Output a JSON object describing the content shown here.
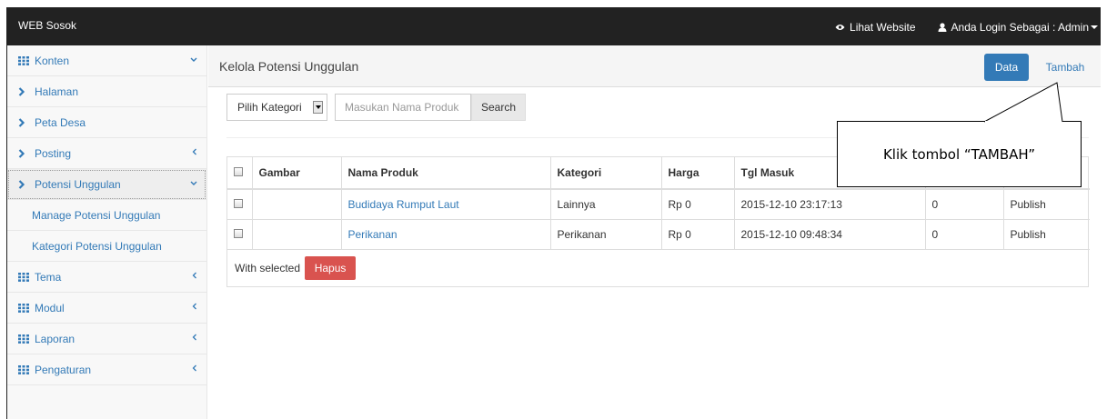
{
  "topbar": {
    "brand": "WEB Sosok",
    "view_site": "Lihat Website",
    "user": "Anda Login Sebagai : Admin"
  },
  "sidebar": {
    "items": [
      {
        "label": "Konten",
        "icon": "grid-icon",
        "arrow": "down"
      },
      {
        "label": "Halaman",
        "icon": "chevron-right-icon"
      },
      {
        "label": "Peta Desa",
        "icon": "chevron-right-icon"
      },
      {
        "label": "Posting",
        "icon": "chevron-right-icon",
        "arrow": "left"
      },
      {
        "label": "Potensi Unggulan",
        "icon": "chevron-right-icon",
        "arrow": "down",
        "active": true
      },
      {
        "label": "Manage Potensi Unggulan",
        "sub": true
      },
      {
        "label": "Kategori Potensi Unggulan",
        "sub": true
      },
      {
        "label": "Tema",
        "icon": "grid-icon",
        "arrow": "left"
      },
      {
        "label": "Modul",
        "icon": "grid-icon",
        "arrow": "left"
      },
      {
        "label": "Laporan",
        "icon": "grid-icon",
        "arrow": "left"
      },
      {
        "label": "Pengaturan",
        "icon": "grid-icon",
        "arrow": "left"
      }
    ]
  },
  "main": {
    "title": "Kelola Potensi Unggulan",
    "data_button": "Data",
    "add_button": "Tambah",
    "filter": {
      "category_selected": "Pilih Kategori",
      "search_placeholder": "Masukan Nama Produk",
      "search_button": "Search"
    },
    "table": {
      "headers": [
        "Gambar",
        "Nama Produk",
        "Kategori",
        "Harga",
        "Tgl Masuk",
        "",
        ""
      ],
      "rows": [
        {
          "name": "Budidaya Rumput Laut",
          "category": "Lainnya",
          "price": "Rp 0",
          "date": "2015-12-10 23:17:13",
          "count": "0",
          "status": "Publish"
        },
        {
          "name": "Perikanan",
          "category": "Perikanan",
          "price": "Rp 0",
          "date": "2015-12-10 09:48:34",
          "count": "0",
          "status": "Publish"
        }
      ]
    },
    "with_selected": "With selected",
    "delete_button": "Hapus"
  },
  "callout": {
    "text": "Klik tombol “TAMBAH”"
  },
  "colors": {
    "topbar": "#222222",
    "primary": "#337ab7",
    "danger": "#d9534f"
  }
}
